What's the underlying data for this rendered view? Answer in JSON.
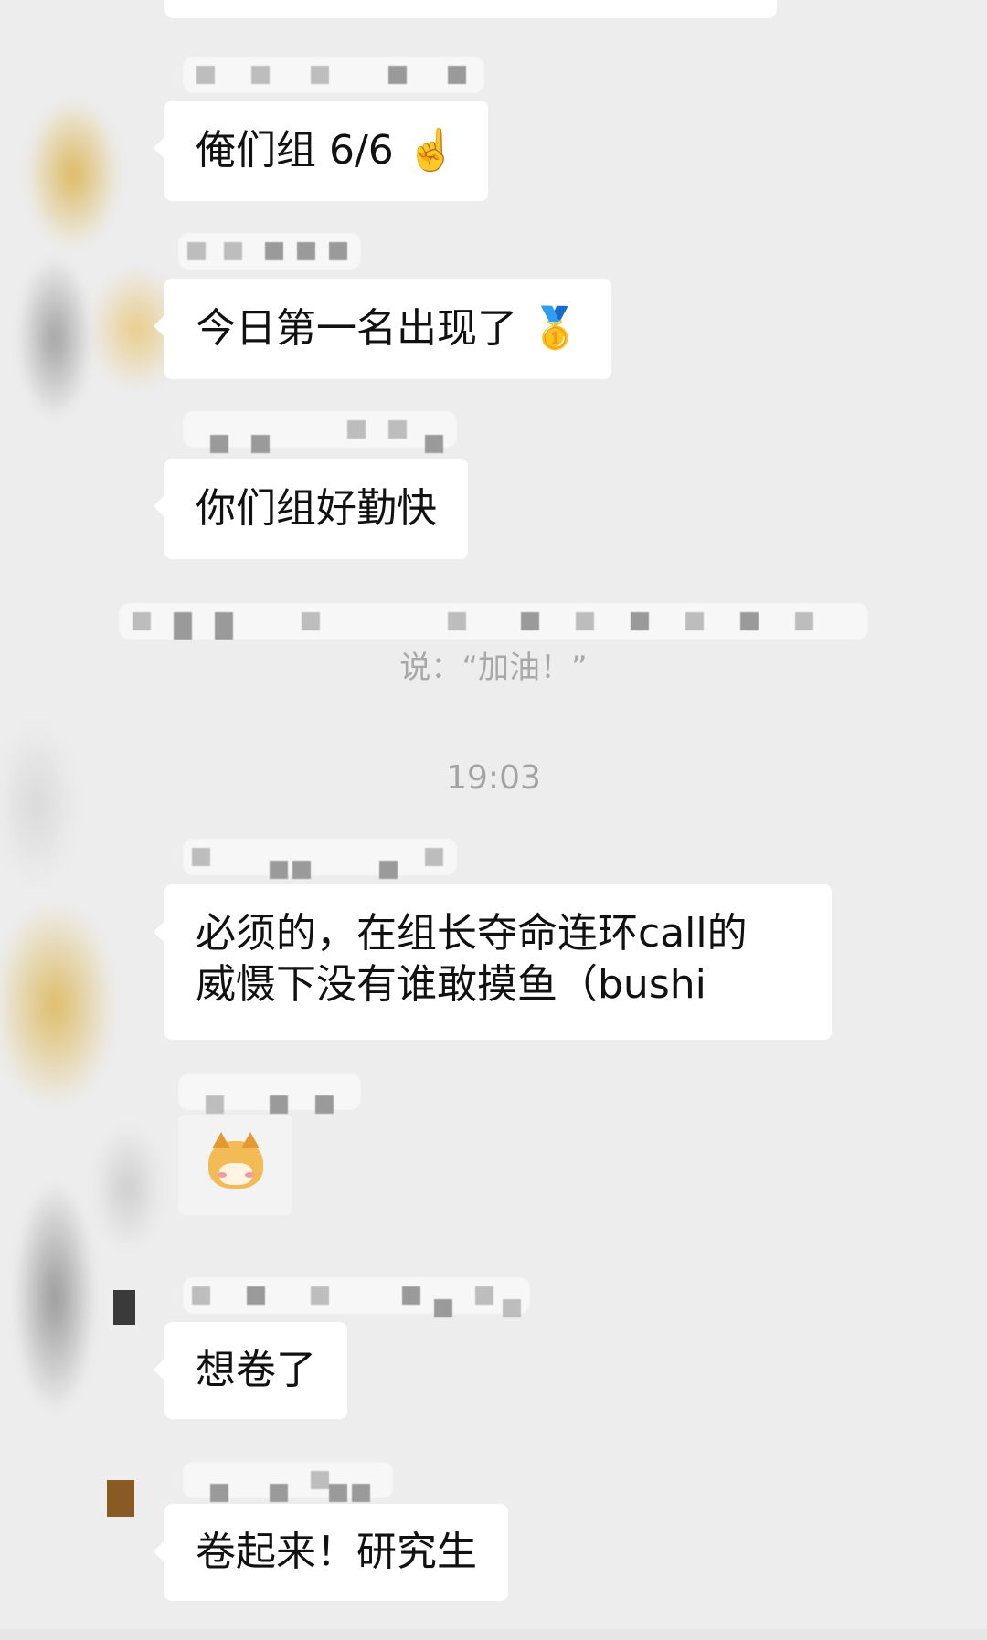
{
  "messages": {
    "m1": {
      "text": "俺们组 6/6",
      "emoji": "☝️"
    },
    "m2": {
      "text": "今日第一名出现了",
      "emoji": "🥇"
    },
    "m3": {
      "text": "你们组好勤快"
    },
    "system_message": "说：“加油！”",
    "timestamp": "19:03",
    "m4": {
      "line1": "必须的，在组长夺命连环call的",
      "line2": "威慑下没有谁敢摸鱼（bushi"
    },
    "m5": {
      "sticker": "cat-sticker-icon"
    },
    "m6": {
      "text": "想卷了"
    },
    "m7": {
      "text": "卷起来！研究生"
    }
  },
  "colors": {
    "background": "#ededed",
    "bubble": "#ffffff",
    "system_text": "#a8a8a8"
  }
}
